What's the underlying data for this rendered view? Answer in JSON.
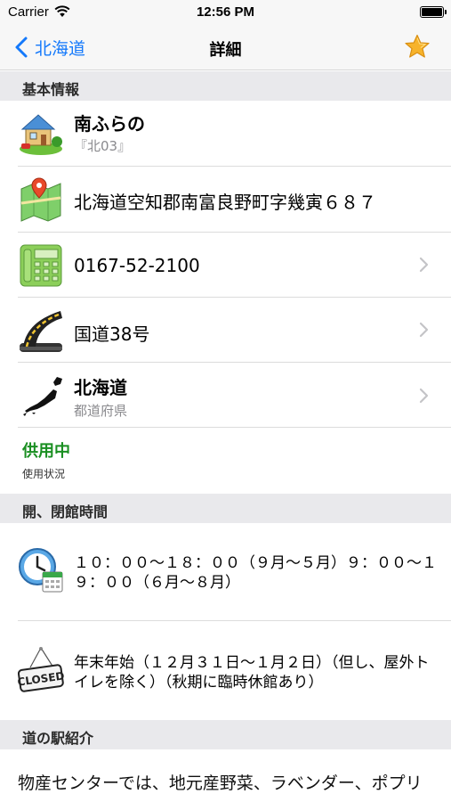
{
  "status_bar": {
    "carrier": "Carrier",
    "time": "12:56 PM"
  },
  "nav": {
    "back_label": "北海道",
    "title": "詳細"
  },
  "sections": {
    "basic": "基本情報",
    "hours": "開、閉館時間",
    "intro": "道の駅紹介"
  },
  "basic": {
    "name": "南ふらの",
    "code": "『北03』",
    "address": "北海道空知郡南富良野町字幾寅６８７",
    "phone": "0167-52-2100",
    "route": "国道38号",
    "prefecture": "北海道",
    "prefecture_caption": "都道府県",
    "status": "供用中",
    "status_caption": "使用状況"
  },
  "hours": {
    "open": "１０：００〜１８：００（９月〜５月）９：００〜１９：００（６月〜８月）",
    "closed": "年末年始（１２月３１日〜１月２日）（但し、屋外トイレを除く）（秋期に臨時休館あり）"
  },
  "intro": {
    "text": "物産センターでは、地元産野菜、ラベンダー、ポプリ等を販売しています。そのほか、ゆでたて"
  },
  "icons": {
    "back": "chevron-left-icon",
    "favorite": "star-icon",
    "station": "house-icon",
    "address": "map-pin-icon",
    "phone": "phone-icon",
    "route": "road-icon",
    "prefecture": "japan-map-icon",
    "hours": "clock-calendar-icon",
    "closed": "closed-sign-icon"
  },
  "colors": {
    "accent": "#1479fb",
    "status_green": "#1a8f22",
    "star": "#f7b32b"
  }
}
